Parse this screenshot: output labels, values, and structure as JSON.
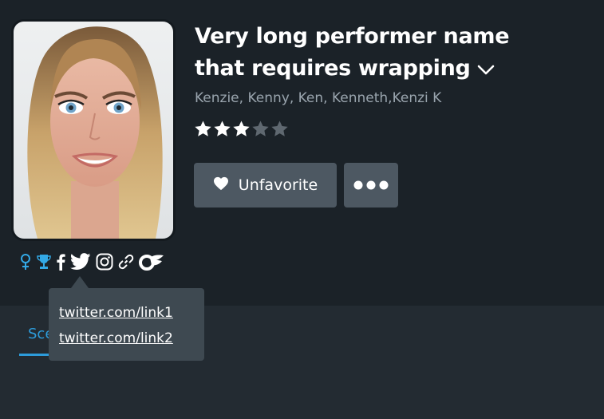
{
  "performer": {
    "name": "Very long performer name that requires wrapping",
    "aliases": "Kenzie, Kenny, Ken, Kenneth,Kenzi K",
    "rating": 3,
    "rating_max": 5
  },
  "actions": {
    "favorite_label": "Unfavorite",
    "more_label": "•••"
  },
  "links": {
    "icons": [
      "female-icon",
      "trophy-icon",
      "facebook-icon",
      "twitter-icon",
      "instagram-icon",
      "link-icon",
      "onlyfans-icon"
    ],
    "twitter_tooltip": [
      "twitter.com/link1",
      "twitter.com/link2"
    ]
  },
  "tabs": [
    {
      "label": "Scenes"
    }
  ],
  "colors": {
    "background": "#1b2228",
    "button": "#4d5862",
    "tooltip": "#3e4951",
    "accent": "#2d9cdb",
    "link_icons": "#33a9e6"
  }
}
